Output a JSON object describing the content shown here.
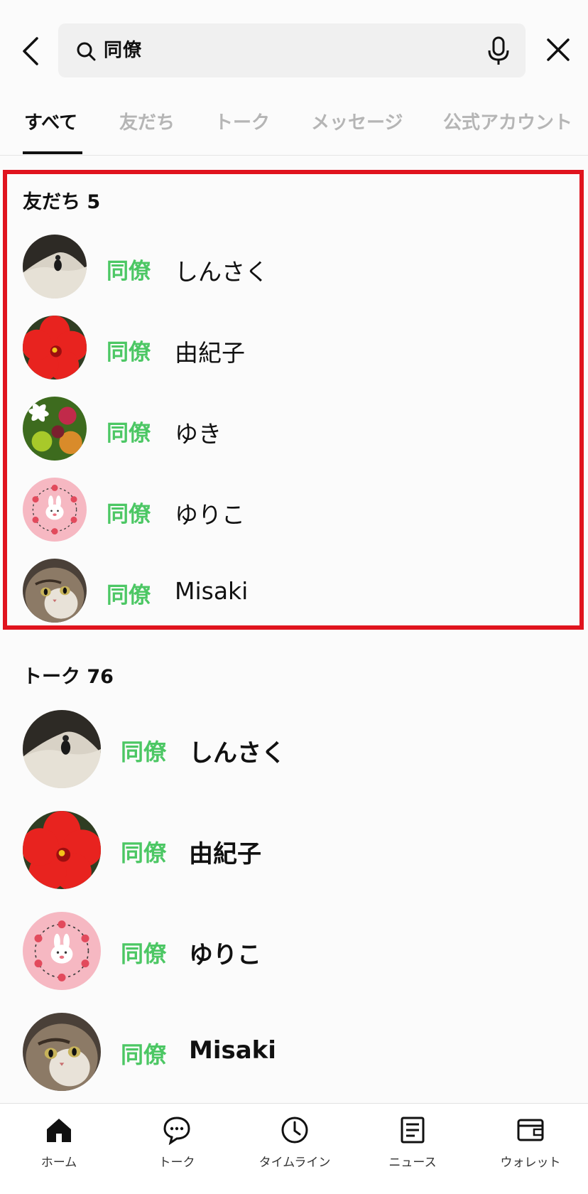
{
  "search": {
    "query": "同僚"
  },
  "tabs": [
    {
      "label": "すべて",
      "active": true
    },
    {
      "label": "友だち",
      "active": false
    },
    {
      "label": "トーク",
      "active": false
    },
    {
      "label": "メッセージ",
      "active": false
    },
    {
      "label": "公式アカウント",
      "active": false
    }
  ],
  "friends": {
    "title": "友だち 5",
    "items": [
      {
        "tag": "同僚",
        "name": "しんさく",
        "avatar": "cave-photo"
      },
      {
        "tag": "同僚",
        "name": "由紀子",
        "avatar": "red-hibiscus"
      },
      {
        "tag": "同僚",
        "name": "ゆき",
        "avatar": "lily-garden"
      },
      {
        "tag": "同僚",
        "name": "ゆりこ",
        "avatar": "pink-bunny-wreath"
      },
      {
        "tag": "同僚",
        "name": "Misaki",
        "avatar": "tabby-cat"
      }
    ]
  },
  "talks": {
    "title": "トーク 76",
    "items": [
      {
        "tag": "同僚",
        "name": "しんさく",
        "avatar": "cave-photo"
      },
      {
        "tag": "同僚",
        "name": "由紀子",
        "avatar": "red-hibiscus"
      },
      {
        "tag": "同僚",
        "name": "ゆりこ",
        "avatar": "pink-bunny-wreath"
      },
      {
        "tag": "同僚",
        "name": "Misaki",
        "avatar": "tabby-cat"
      }
    ]
  },
  "nav": [
    {
      "label": "ホーム",
      "icon": "home-icon"
    },
    {
      "label": "トーク",
      "icon": "chat-bubble-icon"
    },
    {
      "label": "タイムライン",
      "icon": "clock-icon"
    },
    {
      "label": "ニュース",
      "icon": "news-icon"
    },
    {
      "label": "ウォレット",
      "icon": "wallet-icon"
    }
  ],
  "colors": {
    "tag": "#4cc764",
    "highlight": "#e0141e",
    "tab_inactive": "#b5b5b5"
  }
}
